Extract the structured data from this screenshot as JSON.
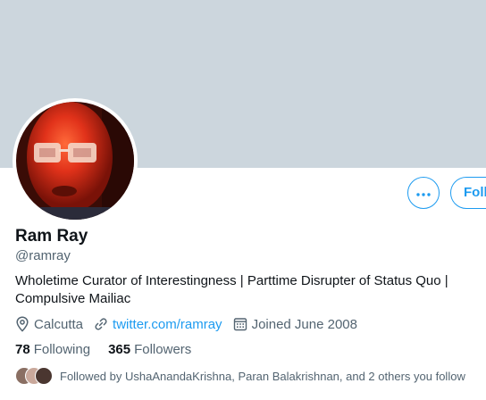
{
  "profile": {
    "name": "Ram Ray",
    "handle": "@ramray",
    "bio": "Wholetime Curator of Interestingness | Parttime Disrupter of Status Quo | Compulsive Mailiac",
    "location": "Calcutta",
    "website": "twitter.com/ramray",
    "joined": "Joined June 2008"
  },
  "actions": {
    "follow_label": "Follow",
    "more_icon": "more-horizontal-icon"
  },
  "stats": {
    "following_count": "78",
    "following_label": "Following",
    "followers_count": "365",
    "followers_label": "Followers"
  },
  "followed_by": {
    "text": "Followed by UshaAnandaKrishna, Paran Balakrishnan, and 2 others you follow"
  },
  "icons": {
    "location": "location-pin-icon",
    "website": "link-icon",
    "joined": "calendar-icon"
  },
  "colors": {
    "banner": "#ccd6dd",
    "accent": "#1d9bf0",
    "secondary_text": "#536471",
    "primary_text": "#0f1419"
  }
}
